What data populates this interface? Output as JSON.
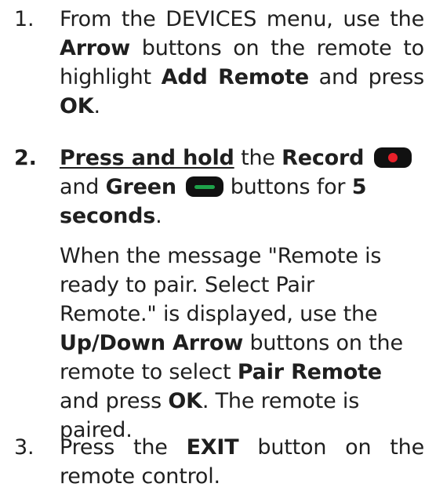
{
  "colors": {
    "text": "#1f1f1f",
    "record_dot": "#e8202a",
    "green_bar": "#1ea24a",
    "button_body": "#111111"
  },
  "steps": [
    {
      "number": "1.",
      "t1": "From the DEVICES menu, use the",
      "b1": "Arrow",
      "t2": " buttons on the remote to highlight ",
      "b2": "Add Remote",
      "t3": " and press ",
      "b3": "OK",
      "t4": "."
    },
    {
      "number": "2.",
      "u1": "Press and hold",
      "t1": " the ",
      "b1": "Record",
      "btn1_icon": "record-button-icon",
      "t2": "and ",
      "b2": "Green",
      "btn2_icon": "green-button-icon",
      "t3": " buttons for ",
      "b3": "5 seconds",
      "t4": "."
    },
    {
      "number": "3.",
      "t1": "Press the ",
      "b1": "EXIT",
      "t2": " button on the remote control."
    }
  ],
  "note": {
    "t1": "When the message \"Remote is ready to pair. Select Pair Remote.\" is displayed, use the ",
    "b1": "Up/Down Arrow",
    "t2": " buttons on the remote to select ",
    "b2": "Pair Remote",
    "t3": " and press ",
    "b3": "OK",
    "t4": ". The remote is paired."
  }
}
